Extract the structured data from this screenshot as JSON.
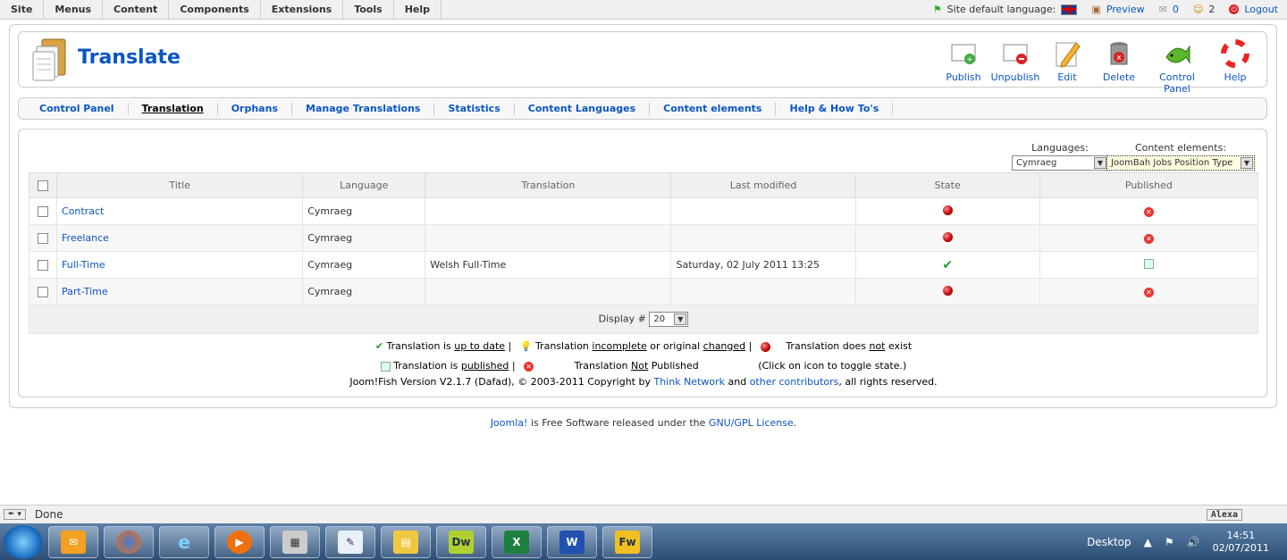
{
  "topmenu": {
    "items": [
      "Site",
      "Menus",
      "Content",
      "Components",
      "Extensions",
      "Tools",
      "Help"
    ],
    "site_default_language": "Site default language:",
    "preview": "Preview",
    "messages": "0",
    "users": "2",
    "logout": "Logout"
  },
  "header": {
    "title": "Translate",
    "buttons": [
      "Publish",
      "Unpublish",
      "Edit",
      "Delete",
      "Control Panel",
      "Help"
    ]
  },
  "submenu": {
    "items": [
      "Control Panel",
      "Translation",
      "Orphans",
      "Manage Translations",
      "Statistics",
      "Content Languages",
      "Content elements",
      "Help & How To's"
    ],
    "active": "Translation"
  },
  "filters": {
    "languages_label": "Languages:",
    "languages_value": "Cymraeg",
    "elements_label": "Content elements:",
    "elements_value": "JoomBah Jobs Position Type"
  },
  "table": {
    "headers": [
      "Title",
      "Language",
      "Translation",
      "Last modified",
      "State",
      "Published"
    ],
    "rows": [
      {
        "title": "Contract",
        "language": "Cymraeg",
        "translation": "",
        "modified": "",
        "state": "missing",
        "published": "no"
      },
      {
        "title": "Freelance",
        "language": "Cymraeg",
        "translation": "",
        "modified": "",
        "state": "missing",
        "published": "no"
      },
      {
        "title": "Full-Time",
        "language": "Cymraeg",
        "translation": "Welsh Full-Time",
        "modified": "Saturday, 02 July 2011 13:25",
        "state": "uptodate",
        "published": "yes"
      },
      {
        "title": "Part-Time",
        "language": "Cymraeg",
        "translation": "",
        "modified": "",
        "state": "missing",
        "published": "no"
      }
    ],
    "display_label": "Display #",
    "display_value": "20"
  },
  "legend": {
    "l1_a": "Translation is ",
    "l1_a_u": "up to date",
    "l1_b": "Translation ",
    "l1_b_u1": "incomplete",
    "l1_b_mid": " or original ",
    "l1_b_u2": "changed",
    "l1_c": "Translation does ",
    "l1_c_u": "not",
    "l1_c_end": " exist",
    "l2_a": "Translation is ",
    "l2_a_u": "published",
    "l2_b": "Translation ",
    "l2_b_u": "Not",
    "l2_b_end": " Published",
    "l2_c": "(Click on icon to toggle state.)",
    "version_a": "Joom!Fish Version V2.1.7 (Dafad), © 2003-2011 Copyright by ",
    "version_link1": "Think Network",
    "version_mid": " and ",
    "version_link2": "other contributors",
    "version_end": ", all rights reserved."
  },
  "footer": {
    "link": "Joomla!",
    "text": " is Free Software released under the ",
    "license": "GNU/GPL License",
    "end": "."
  },
  "statusbar": {
    "done": "Done",
    "alexa": "Alexa"
  },
  "taskbar": {
    "desktop": "Desktop",
    "time": "14:51",
    "date": "02/07/2011",
    "apps": [
      "Dw",
      "Fw"
    ]
  },
  "colors": {
    "link": "#0b55c4",
    "border": "#cccccc"
  }
}
